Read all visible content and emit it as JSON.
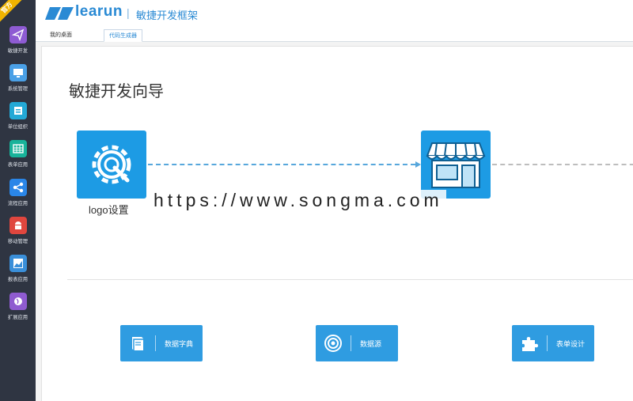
{
  "header": {
    "brand": "learun",
    "separator": "|",
    "subtitle": "敏捷开发框架"
  },
  "sidebar": {
    "ribbon": "官方",
    "items": [
      {
        "label": "敏捷开发",
        "icon": "paper-plane-icon",
        "color": "#8e5bd3"
      },
      {
        "label": "系统管理",
        "icon": "monitor-icon",
        "color": "#4aa0e6"
      },
      {
        "label": "单位组织",
        "icon": "badge-icon",
        "color": "#23a9d6"
      },
      {
        "label": "表单应用",
        "icon": "table-icon",
        "color": "#18b39a"
      },
      {
        "label": "流程应用",
        "icon": "share-icon",
        "color": "#2a86e8"
      },
      {
        "label": "移动管理",
        "icon": "android-icon",
        "color": "#e0463e"
      },
      {
        "label": "报表应用",
        "icon": "chart-icon",
        "color": "#3a8fd9"
      },
      {
        "label": "扩展应用",
        "icon": "globe-icon",
        "color": "#8f5bd0"
      }
    ]
  },
  "tabs": [
    {
      "label": "我的桌面"
    },
    {
      "label": "代码生成器"
    }
  ],
  "main": {
    "title": "敏捷开发向导",
    "steps": [
      {
        "label": "logo设置",
        "icon": "gear-wrench-icon"
      },
      {
        "label": "",
        "icon": "store-icon"
      }
    ],
    "watermark": "https://www.songma.com",
    "tools": [
      {
        "label": "数据字典",
        "icon": "book-icon"
      },
      {
        "label": "数据源",
        "icon": "target-icon"
      },
      {
        "label": "表单设计",
        "icon": "puzzle-icon"
      }
    ]
  },
  "colors": {
    "sidebar_bg": "#2f3542",
    "brand_blue": "#2a8ad4",
    "step_blue": "#1d9be4",
    "button_blue": "#2f9ce1"
  }
}
